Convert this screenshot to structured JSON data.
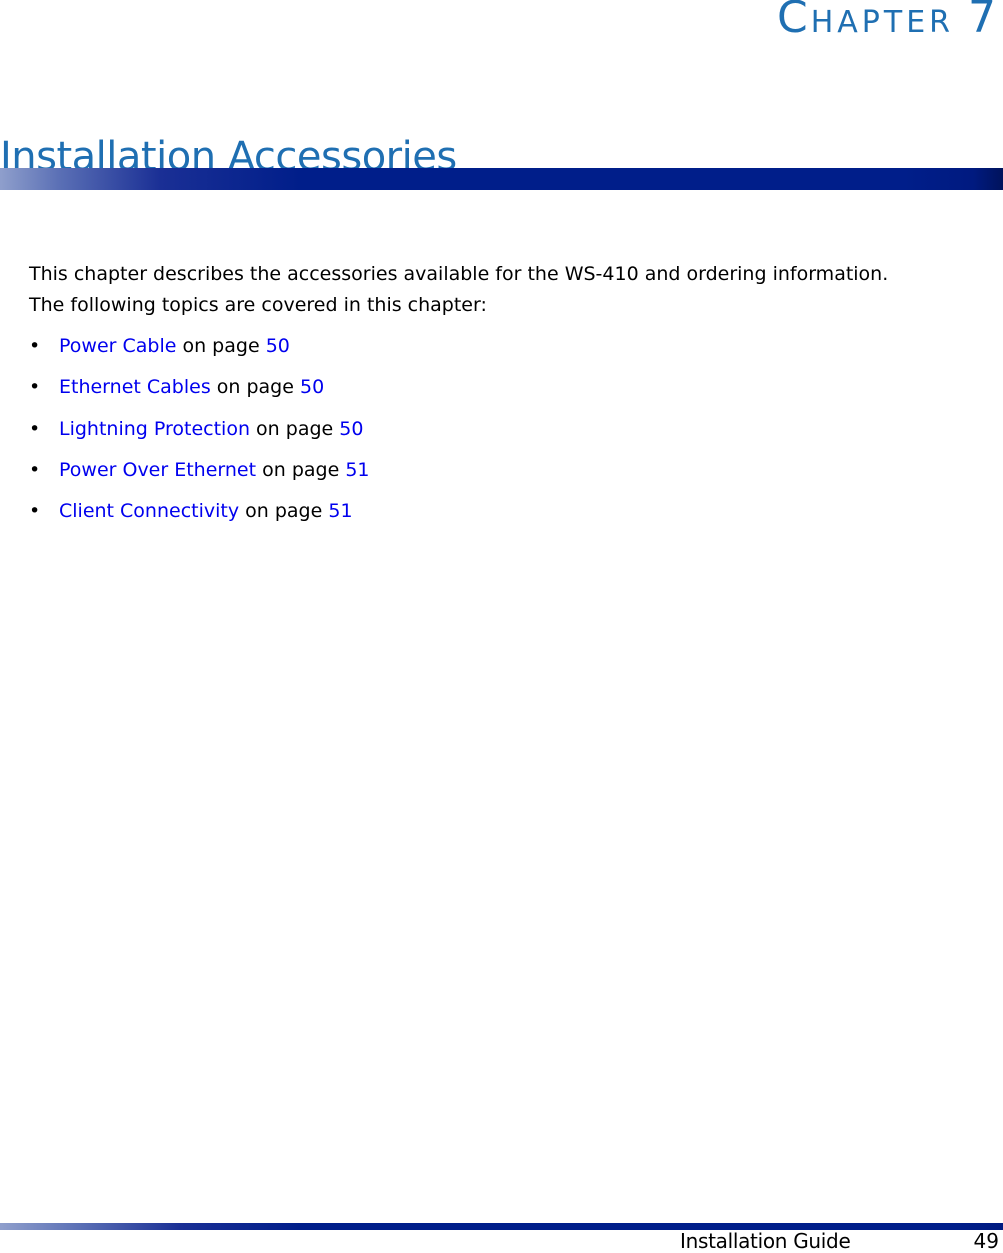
{
  "header": {
    "chapter_first_letter": "C",
    "chapter_rest": "HAPTER",
    "chapter_number": "7",
    "title": "Installation Accessories"
  },
  "intro": {
    "line1": "This chapter describes the accessories available for the WS-410 and ordering information.",
    "line2": "The following topics are covered in this chapter:"
  },
  "topics": [
    {
      "bullet": "•",
      "link": "Power Cable",
      "middle": " on page ",
      "page": "50"
    },
    {
      "bullet": "•",
      "link": "Ethernet Cables",
      "middle": " on page ",
      "page": "50"
    },
    {
      "bullet": "•",
      "link": "Lightning Protection",
      "middle": " on page ",
      "page": "50"
    },
    {
      "bullet": "•",
      "link": "Power Over Ethernet",
      "middle": " on page ",
      "page": "51"
    },
    {
      "bullet": "•",
      "link": "Client Connectivity",
      "middle": " on page ",
      "page": "51"
    }
  ],
  "footer": {
    "guide_name": "Installation Guide",
    "page_number": "49"
  },
  "colors": {
    "heading": "#1f6fb2",
    "link": "#0000ee",
    "bar": "#001e8a"
  }
}
